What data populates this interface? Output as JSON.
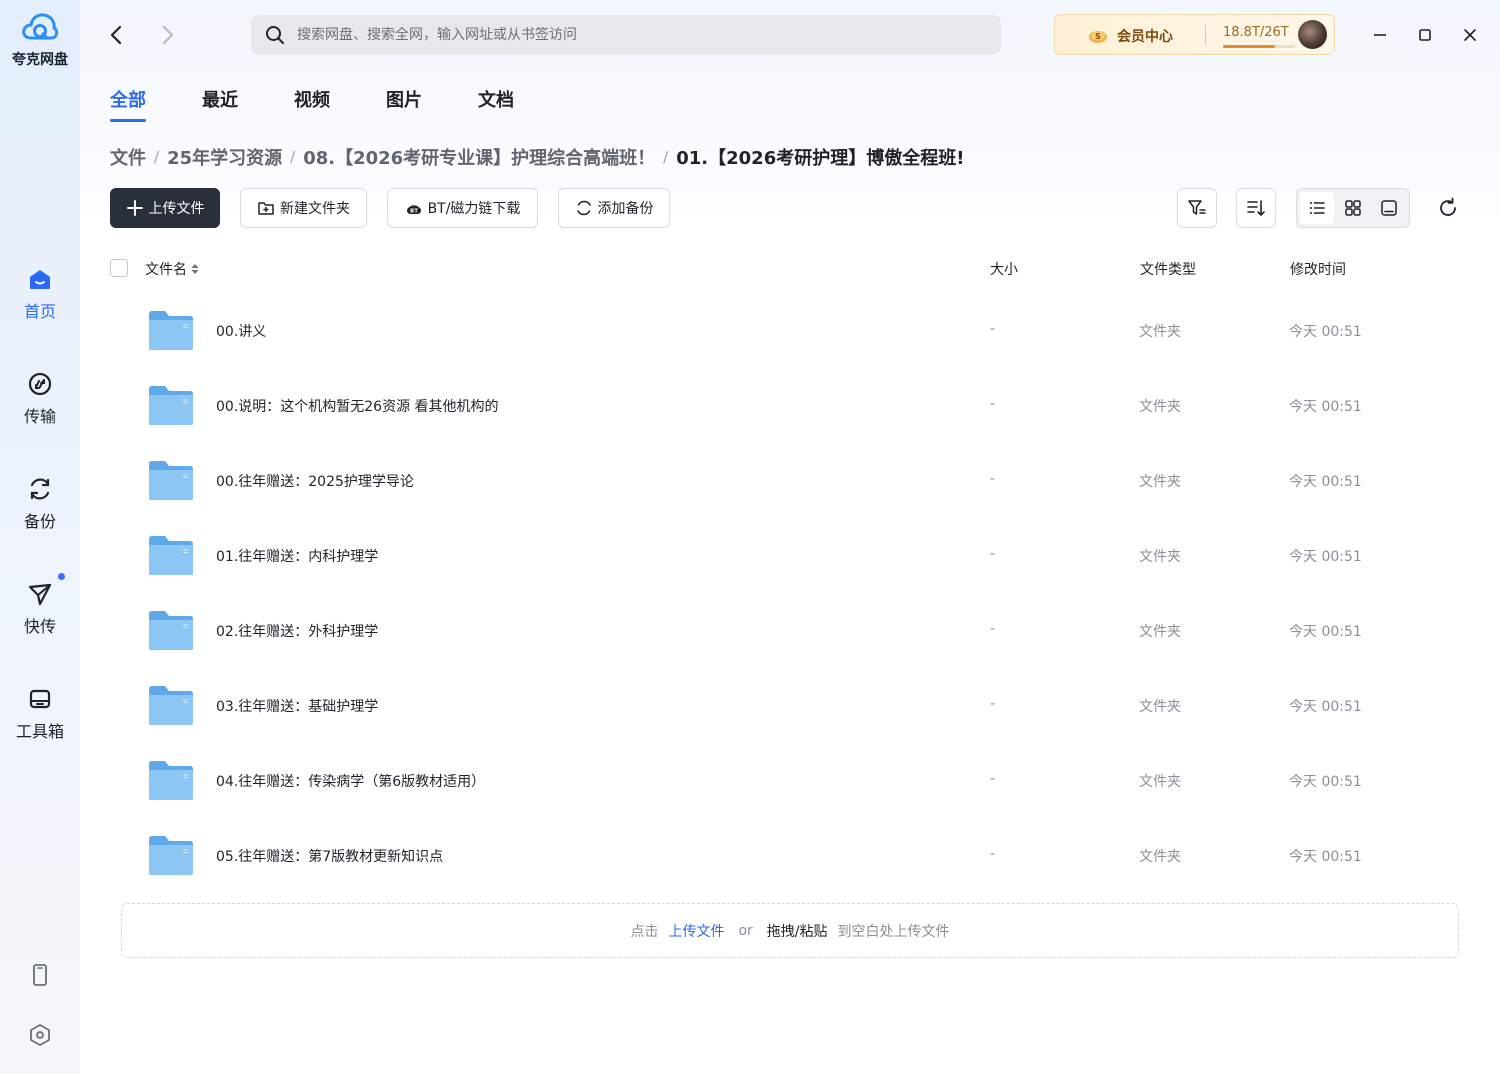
{
  "app": {
    "name": "夸克网盘"
  },
  "sidebar": {
    "items": [
      {
        "label": "首页",
        "icon": "home-icon",
        "active": true
      },
      {
        "label": "传输",
        "icon": "transfer-icon",
        "active": false
      },
      {
        "label": "备份",
        "icon": "backup-icon",
        "active": false
      },
      {
        "label": "快传",
        "icon": "send-icon",
        "active": false,
        "badge_dot": true
      },
      {
        "label": "工具箱",
        "icon": "toolbox-icon",
        "active": false
      }
    ],
    "bottom": [
      "phone-icon",
      "settings-icon"
    ]
  },
  "header": {
    "search": {
      "placeholder": "搜索网盘、搜索全网，输入网址或从书签访问"
    },
    "vip": {
      "label": "会员中心",
      "storage": "18.8T/26T",
      "storage_used_fraction": 0.72
    }
  },
  "tabs": [
    {
      "label": "全部",
      "active": true
    },
    {
      "label": "最近",
      "active": false
    },
    {
      "label": "视频",
      "active": false
    },
    {
      "label": "图片",
      "active": false
    },
    {
      "label": "文档",
      "active": false
    }
  ],
  "breadcrumb": [
    "文件",
    "25年学习资源",
    "08.【2026考研专业课】护理综合高端班！",
    "01.【2026考研护理】博傲全程班!"
  ],
  "toolbar": {
    "upload": "上传文件",
    "new_folder": "新建文件夹",
    "bt_download": "BT/磁力链下载",
    "add_backup": "添加备份"
  },
  "table": {
    "columns": {
      "name": "文件名",
      "size": "大小",
      "type": "文件类型",
      "modified": "修改时间"
    },
    "rows": [
      {
        "name": "00.讲义",
        "size": "-",
        "type": "文件夹",
        "modified": "今天 00:51"
      },
      {
        "name": "00.说明：这个机构暂无26资源 看其他机构的",
        "size": "-",
        "type": "文件夹",
        "modified": "今天 00:51"
      },
      {
        "name": "00.往年赠送：2025护理学导论",
        "size": "-",
        "type": "文件夹",
        "modified": "今天 00:51"
      },
      {
        "name": "01.往年赠送：内科护理学",
        "size": "-",
        "type": "文件夹",
        "modified": "今天 00:51"
      },
      {
        "name": "02.往年赠送：外科护理学",
        "size": "-",
        "type": "文件夹",
        "modified": "今天 00:51"
      },
      {
        "name": "03.往年赠送：基础护理学",
        "size": "-",
        "type": "文件夹",
        "modified": "今天 00:51"
      },
      {
        "name": "04.往年赠送：传染病学（第6版教材适用）",
        "size": "-",
        "type": "文件夹",
        "modified": "今天 00:51"
      },
      {
        "name": "05.往年赠送：第7版教材更新知识点",
        "size": "-",
        "type": "文件夹",
        "modified": "今天 00:51"
      }
    ]
  },
  "dropzone": {
    "prefix": "点击",
    "upload_link": "上传文件",
    "or": "or",
    "drag_paste": "拖拽/粘贴",
    "suffix": "到空白处上传文件"
  },
  "colors": {
    "accent": "#2c68f6",
    "primary_button": "#2a2f3c",
    "folder": "#7fbcf0"
  }
}
